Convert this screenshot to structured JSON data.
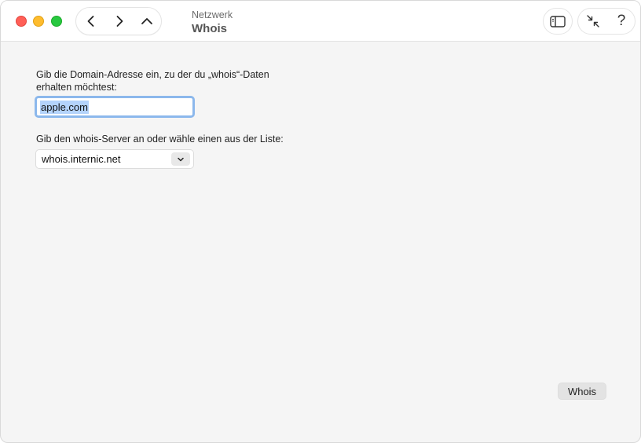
{
  "window": {
    "subtitle": "Netzwerk",
    "title": "Whois"
  },
  "toolbar": {
    "back_icon": "chevron-left-icon",
    "forward_icon": "chevron-right-icon",
    "up_icon": "chevron-up-icon",
    "sidebar_icon": "sidebar-icon",
    "collapse_icon": "arrows-inward-icon",
    "help_label": "?"
  },
  "form": {
    "domain_label": "Gib die Domain-Adresse ein, zu der du „whois“-Daten erhalten möchtest:",
    "domain_value": "apple.com",
    "server_label": "Gib den whois-Server an oder wähle einen aus der Liste:",
    "server_value": "whois.internic.net"
  },
  "actions": {
    "whois_label": "Whois"
  },
  "colors": {
    "close": "#ff5f57",
    "minimize": "#febc2e",
    "maximize": "#28c840",
    "focus_ring": "#8cb8ec",
    "selection": "#b4d3fb"
  }
}
